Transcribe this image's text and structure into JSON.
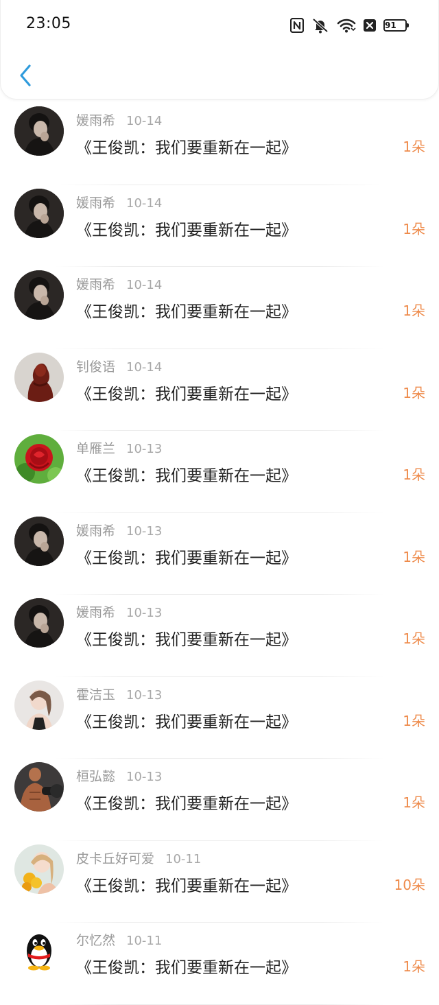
{
  "status_bar": {
    "time": "23:05",
    "battery": "91",
    "icons": [
      "nfc-icon",
      "bell-off-icon",
      "wifi-icon",
      "sim-off-icon",
      "battery-icon"
    ]
  },
  "header": {
    "back_icon": "chevron-left-icon"
  },
  "colors": {
    "accent_blue": "#2f9bdc",
    "flower_orange": "#ee8a4a",
    "meta_gray": "#9a9a9a"
  },
  "items": [
    {
      "name": "媛雨希",
      "date": "10-14",
      "title": "《王俊凯：我们要重新在一起》",
      "flowers": "1朵",
      "avatar": "dark-portrait"
    },
    {
      "name": "媛雨希",
      "date": "10-14",
      "title": "《王俊凯：我们要重新在一起》",
      "flowers": "1朵",
      "avatar": "dark-portrait"
    },
    {
      "name": "媛雨希",
      "date": "10-14",
      "title": "《王俊凯：我们要重新在一起》",
      "flowers": "1朵",
      "avatar": "dark-portrait"
    },
    {
      "name": "钊俊语",
      "date": "10-14",
      "title": "《王俊凯：我们要重新在一起》",
      "flowers": "1朵",
      "avatar": "red-statue"
    },
    {
      "name": "单雁兰",
      "date": "10-13",
      "title": "《王俊凯：我们要重新在一起》",
      "flowers": "1朵",
      "avatar": "red-rose"
    },
    {
      "name": "媛雨希",
      "date": "10-13",
      "title": "《王俊凯：我们要重新在一起》",
      "flowers": "1朵",
      "avatar": "dark-portrait"
    },
    {
      "name": "媛雨希",
      "date": "10-13",
      "title": "《王俊凯：我们要重新在一起》",
      "flowers": "1朵",
      "avatar": "dark-portrait"
    },
    {
      "name": "霍洁玉",
      "date": "10-13",
      "title": "《王俊凯：我们要重新在一起》",
      "flowers": "1朵",
      "avatar": "girl-portrait"
    },
    {
      "name": "桓弘懿",
      "date": "10-13",
      "title": "《王俊凯：我们要重新在一起》",
      "flowers": "1朵",
      "avatar": "muscle-man"
    },
    {
      "name": "皮卡丘好可爱",
      "date": "10-11",
      "title": "《王俊凯：我们要重新在一起》",
      "flowers": "10朵",
      "avatar": "girl-flowers"
    },
    {
      "name": "尔忆然",
      "date": "10-11",
      "title": "《王俊凯：我们要重新在一起》",
      "flowers": "1朵",
      "avatar": "qq-penguin"
    }
  ]
}
